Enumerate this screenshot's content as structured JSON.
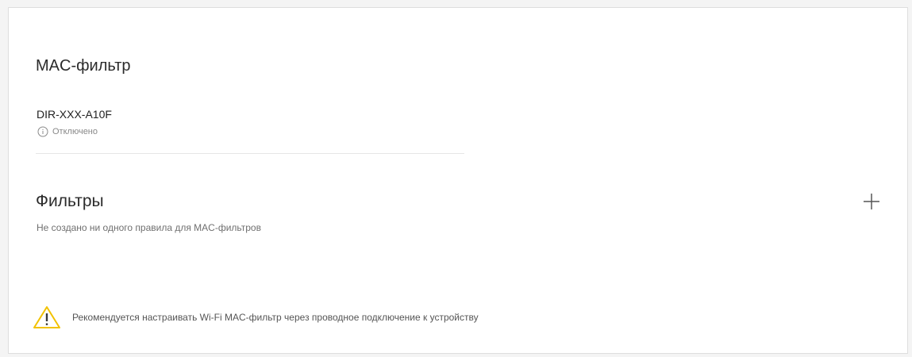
{
  "mac_filter": {
    "title": "MAC-фильтр",
    "device_name": "DIR-XXX-A10F",
    "device_status": "Отключено"
  },
  "filters": {
    "title": "Фильтры",
    "empty_text": "Не создано ни одного правила для MAC-фильтров",
    "add_icon": "plus-icon"
  },
  "warning": {
    "icon": "warning-icon",
    "text": "Рекомендуется настраивать Wi-Fi MAC-фильтр через проводное подключение к устройству"
  },
  "colors": {
    "warning_yellow": "#f2c200",
    "text_dark": "#2b2b2b",
    "text_muted": "#888888"
  }
}
